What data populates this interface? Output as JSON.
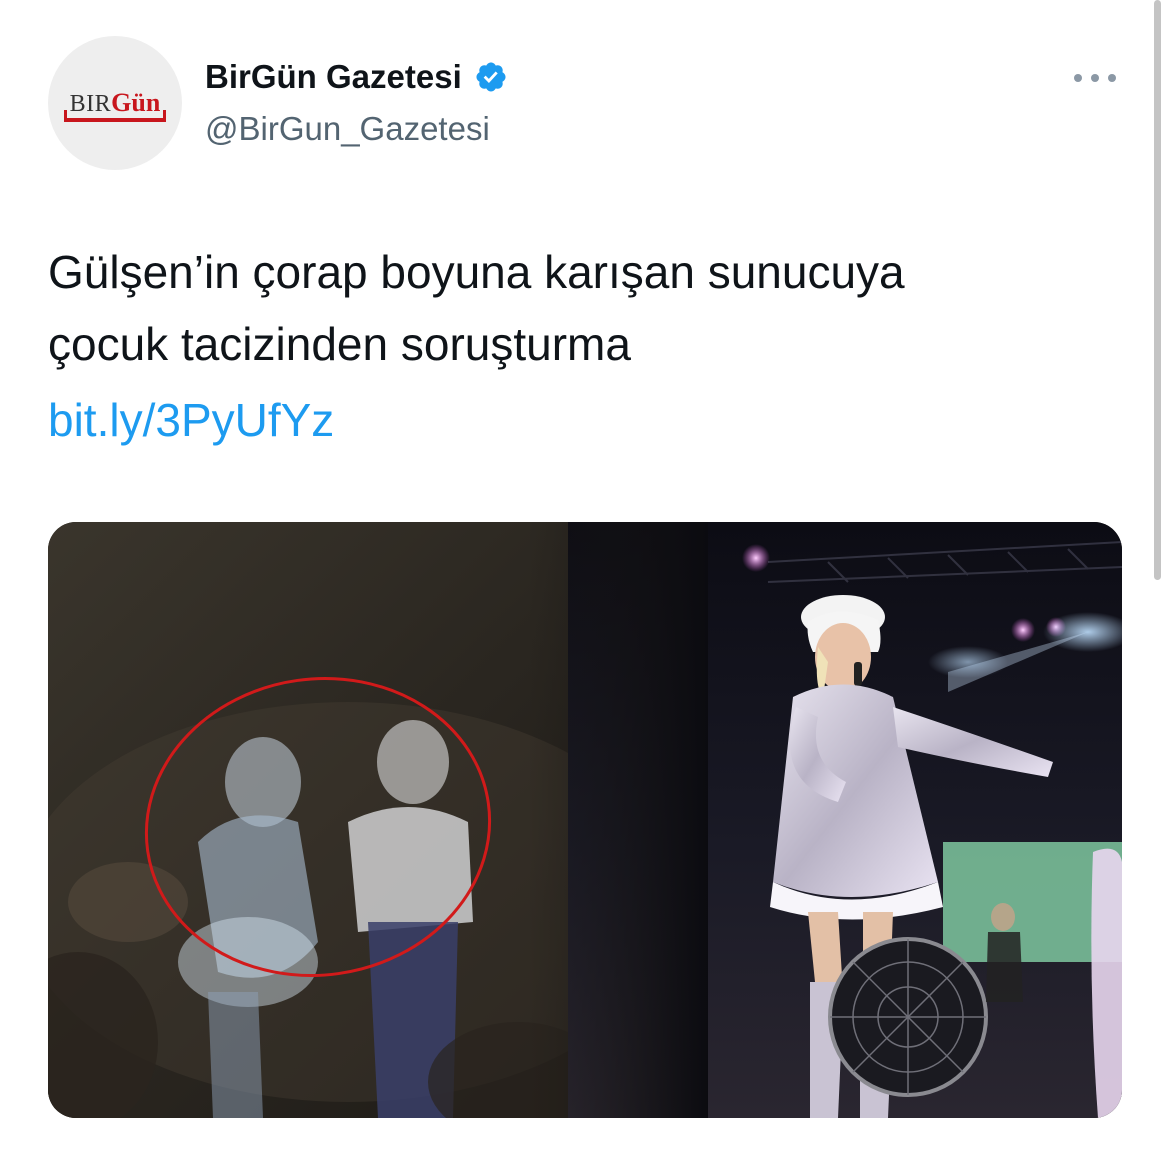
{
  "tweet": {
    "author": {
      "display_name": "BirGün Gazetesi",
      "handle": "@BirGun_Gazetesi",
      "verified": true,
      "avatar_logo": {
        "prefix": "BIR",
        "suffix": "Gün"
      }
    },
    "text_lines": [
      "Gülşen’in çorap boyuna karışan sunucuya",
      "çocuk tacizinden soruşturma"
    ],
    "link": "bit.ly/3PyUfYz",
    "media": {
      "description": "Collage of concert photos: blurry stage frame with a red circle highlighting two people, and a singer in a sequined dress and white beret holding a microphone"
    },
    "icons": {
      "verified": "verified-badge-icon",
      "more": "more-options-icon"
    }
  },
  "colors": {
    "link": "#1d9bf0",
    "verified": "#1d9bf0",
    "secondary_text": "#536471",
    "highlight_circle": "#d11a1a",
    "logo_red": "#c8161d"
  }
}
